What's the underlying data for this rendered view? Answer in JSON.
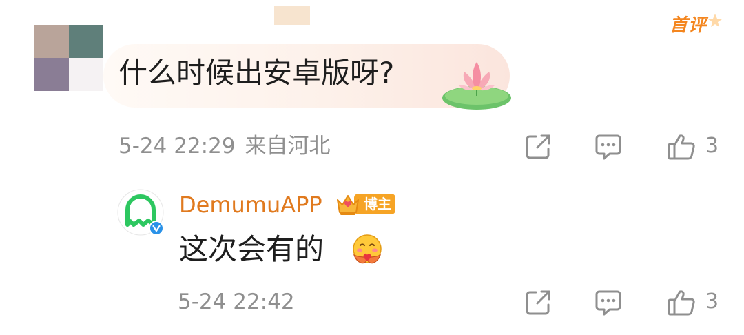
{
  "comment": {
    "badge": "首评",
    "text": "什么时候出安卓版呀?",
    "time": "5-24 22:29",
    "location": "来自河北",
    "like_count": "3"
  },
  "reply": {
    "username": "DemumuAPP",
    "role_badge": "博主",
    "text": "这次会有的",
    "time": "5-24 22:42",
    "like_count": "3"
  },
  "icons": {
    "share": "share-icon",
    "comment": "comment-icon",
    "like": "thumbs-up-icon",
    "verified": "verified-icon",
    "emoji": "hug-emoji-icon",
    "decoration": "lotus-icon"
  },
  "colors": {
    "username": "#e07a1f",
    "badge": "#f4861f",
    "meta": "#8f8f8f",
    "avatar_green": "#2dc760",
    "verified_blue": "#2a92e8"
  }
}
